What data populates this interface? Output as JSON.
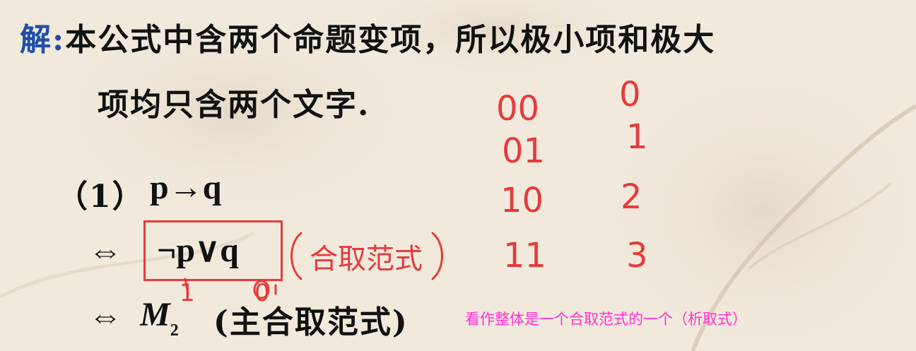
{
  "solution": {
    "label": "解:",
    "line1": "本公式中含两个命题变项，所以极小项和极大",
    "line2": "项均只含两个文字."
  },
  "problem": {
    "number": "（1）",
    "formula": "p→q"
  },
  "steps": [
    {
      "symbol": "⇔",
      "expr": "¬p∨q"
    },
    {
      "symbol": "⇔",
      "expr_main": "M",
      "expr_sub": "2",
      "note": "(主合取范式)"
    }
  ],
  "annotations": {
    "handwritten_label": "合取范式",
    "bits_under_expr": [
      "1",
      "0"
    ],
    "binary_column": [
      "00",
      "01",
      "10",
      "11"
    ],
    "decimal_column": [
      "0",
      "1",
      "2",
      "3"
    ],
    "pink_note": "看作整体是一个合取范式的一个（析取式）"
  },
  "colors": {
    "label_blue": "#1f4fa8",
    "ink_red": "#e53b3b",
    "note_pink": "#ff33cc"
  }
}
